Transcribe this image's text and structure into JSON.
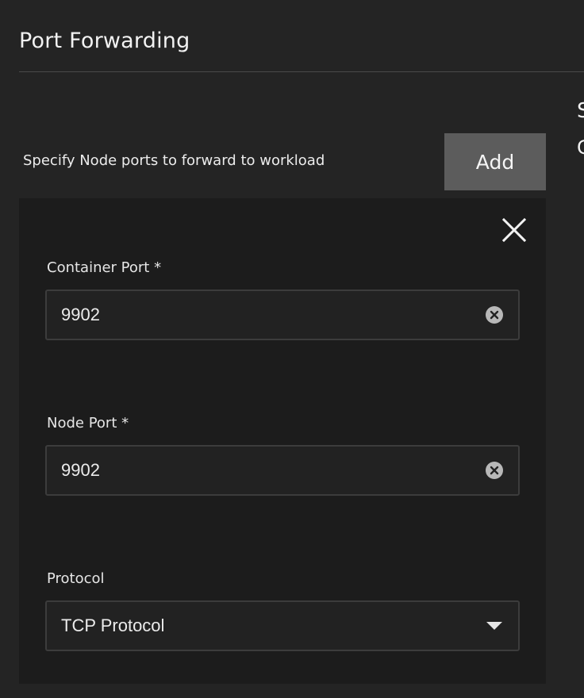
{
  "section": {
    "title": "Port Forwarding"
  },
  "side_panel": {
    "peek_line_1": "S",
    "peek_line_2": "C"
  },
  "port_forwarding": {
    "hint": "Specify Node ports to forward to workload",
    "add_label": "Add",
    "entry": {
      "container_port": {
        "label": "Container Port *",
        "value": "9902"
      },
      "node_port": {
        "label": "Node Port *",
        "value": "9902"
      },
      "protocol": {
        "label": "Protocol",
        "selected": "TCP Protocol"
      }
    }
  },
  "colors": {
    "background": "#242424",
    "card": "#1c1c1c",
    "button": "#5c5c5c",
    "input_border": "#3c3c3c",
    "text": "#e8e8e8"
  },
  "icons": {
    "close": "close-icon",
    "clear": "clear-circle-icon",
    "dropdown": "caret-down-icon"
  }
}
